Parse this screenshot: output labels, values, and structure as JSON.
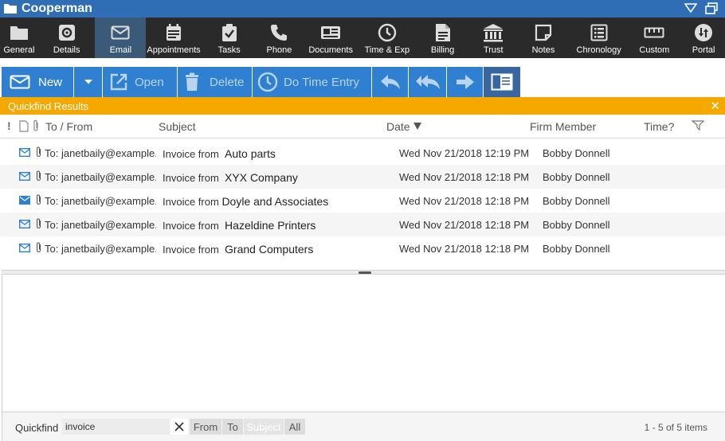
{
  "window": {
    "title": "Cooperman",
    "folder_icon": "folder-icon"
  },
  "mainnav": [
    {
      "label": "General",
      "icon": "folder-icon"
    },
    {
      "label": "Details",
      "icon": "gear-icon"
    },
    {
      "label": "Email",
      "icon": "email-icon"
    },
    {
      "label": "Appointments",
      "icon": "calendar-icon"
    },
    {
      "label": "Tasks",
      "icon": "clipboard-check-icon"
    },
    {
      "label": "Phone",
      "icon": "phone-icon"
    },
    {
      "label": "Documents",
      "icon": "documents-icon"
    },
    {
      "label": "Time & Exp",
      "icon": "clock-icon"
    },
    {
      "label": "Billing",
      "icon": "billing-icon"
    },
    {
      "label": "Trust",
      "icon": "bank-icon"
    },
    {
      "label": "Notes",
      "icon": "note-icon"
    },
    {
      "label": "Chronology",
      "icon": "chronology-icon"
    },
    {
      "label": "Custom",
      "icon": "ruler-icon"
    },
    {
      "label": "Portal",
      "icon": "portal-icon"
    }
  ],
  "toolbar": {
    "new_label": "New",
    "open_label": "Open",
    "delete_label": "Delete",
    "time_entry_label": "Do Time Entry"
  },
  "results": {
    "title": "Quickfind Results"
  },
  "columns": {
    "to_from": "To / From",
    "subject": "Subject",
    "date": "Date",
    "member": "Firm Member",
    "time": "Time?"
  },
  "emails": [
    {
      "to": "To: janetbaily@example.com",
      "subject_prefix": "Invoice from",
      "subject_name": "Auto parts",
      "date": "Wed Nov 21/2018 12:19 PM",
      "member": "Bobby Donnell",
      "read": true
    },
    {
      "to": "To: janetbaily@example.com",
      "subject_prefix": "Invoice from",
      "subject_name": "XYX Company",
      "date": "Wed Nov 21/2018 12:18 PM",
      "member": "Bobby Donnell",
      "read": true
    },
    {
      "to": "To: janetbaily@example.com",
      "subject_prefix": "Invoice from",
      "subject_name": "Doyle and Associates",
      "date": "Wed Nov 21/2018 12:18 PM",
      "member": "Bobby Donnell",
      "read": false
    },
    {
      "to": "To: janetbaily@example.com",
      "subject_prefix": "Invoice from",
      "subject_name": "Hazeldine Printers",
      "date": "Wed Nov 21/2018 12:18 PM",
      "member": "Bobby Donnell",
      "read": true
    },
    {
      "to": "To: janetbaily@example.com",
      "subject_prefix": "Invoice from",
      "subject_name": "Grand Computers",
      "date": "Wed Nov 21/2018 12:18 PM",
      "member": "Bobby Donnell",
      "read": true
    }
  ],
  "quickfind": {
    "label": "Quickfind",
    "value": "invoice",
    "filters": [
      "From",
      "To",
      "Subject",
      "All"
    ],
    "selected_filter": "Subject",
    "count": "1 - 5 of 5 items"
  },
  "colors": {
    "title_bar": "#2f6eb5",
    "nav_bg": "#2a2a2a",
    "toolbar_blue": "#2f80d0",
    "quickfind_orange": "#f5a800",
    "mail_icon": "#2f80d0"
  }
}
